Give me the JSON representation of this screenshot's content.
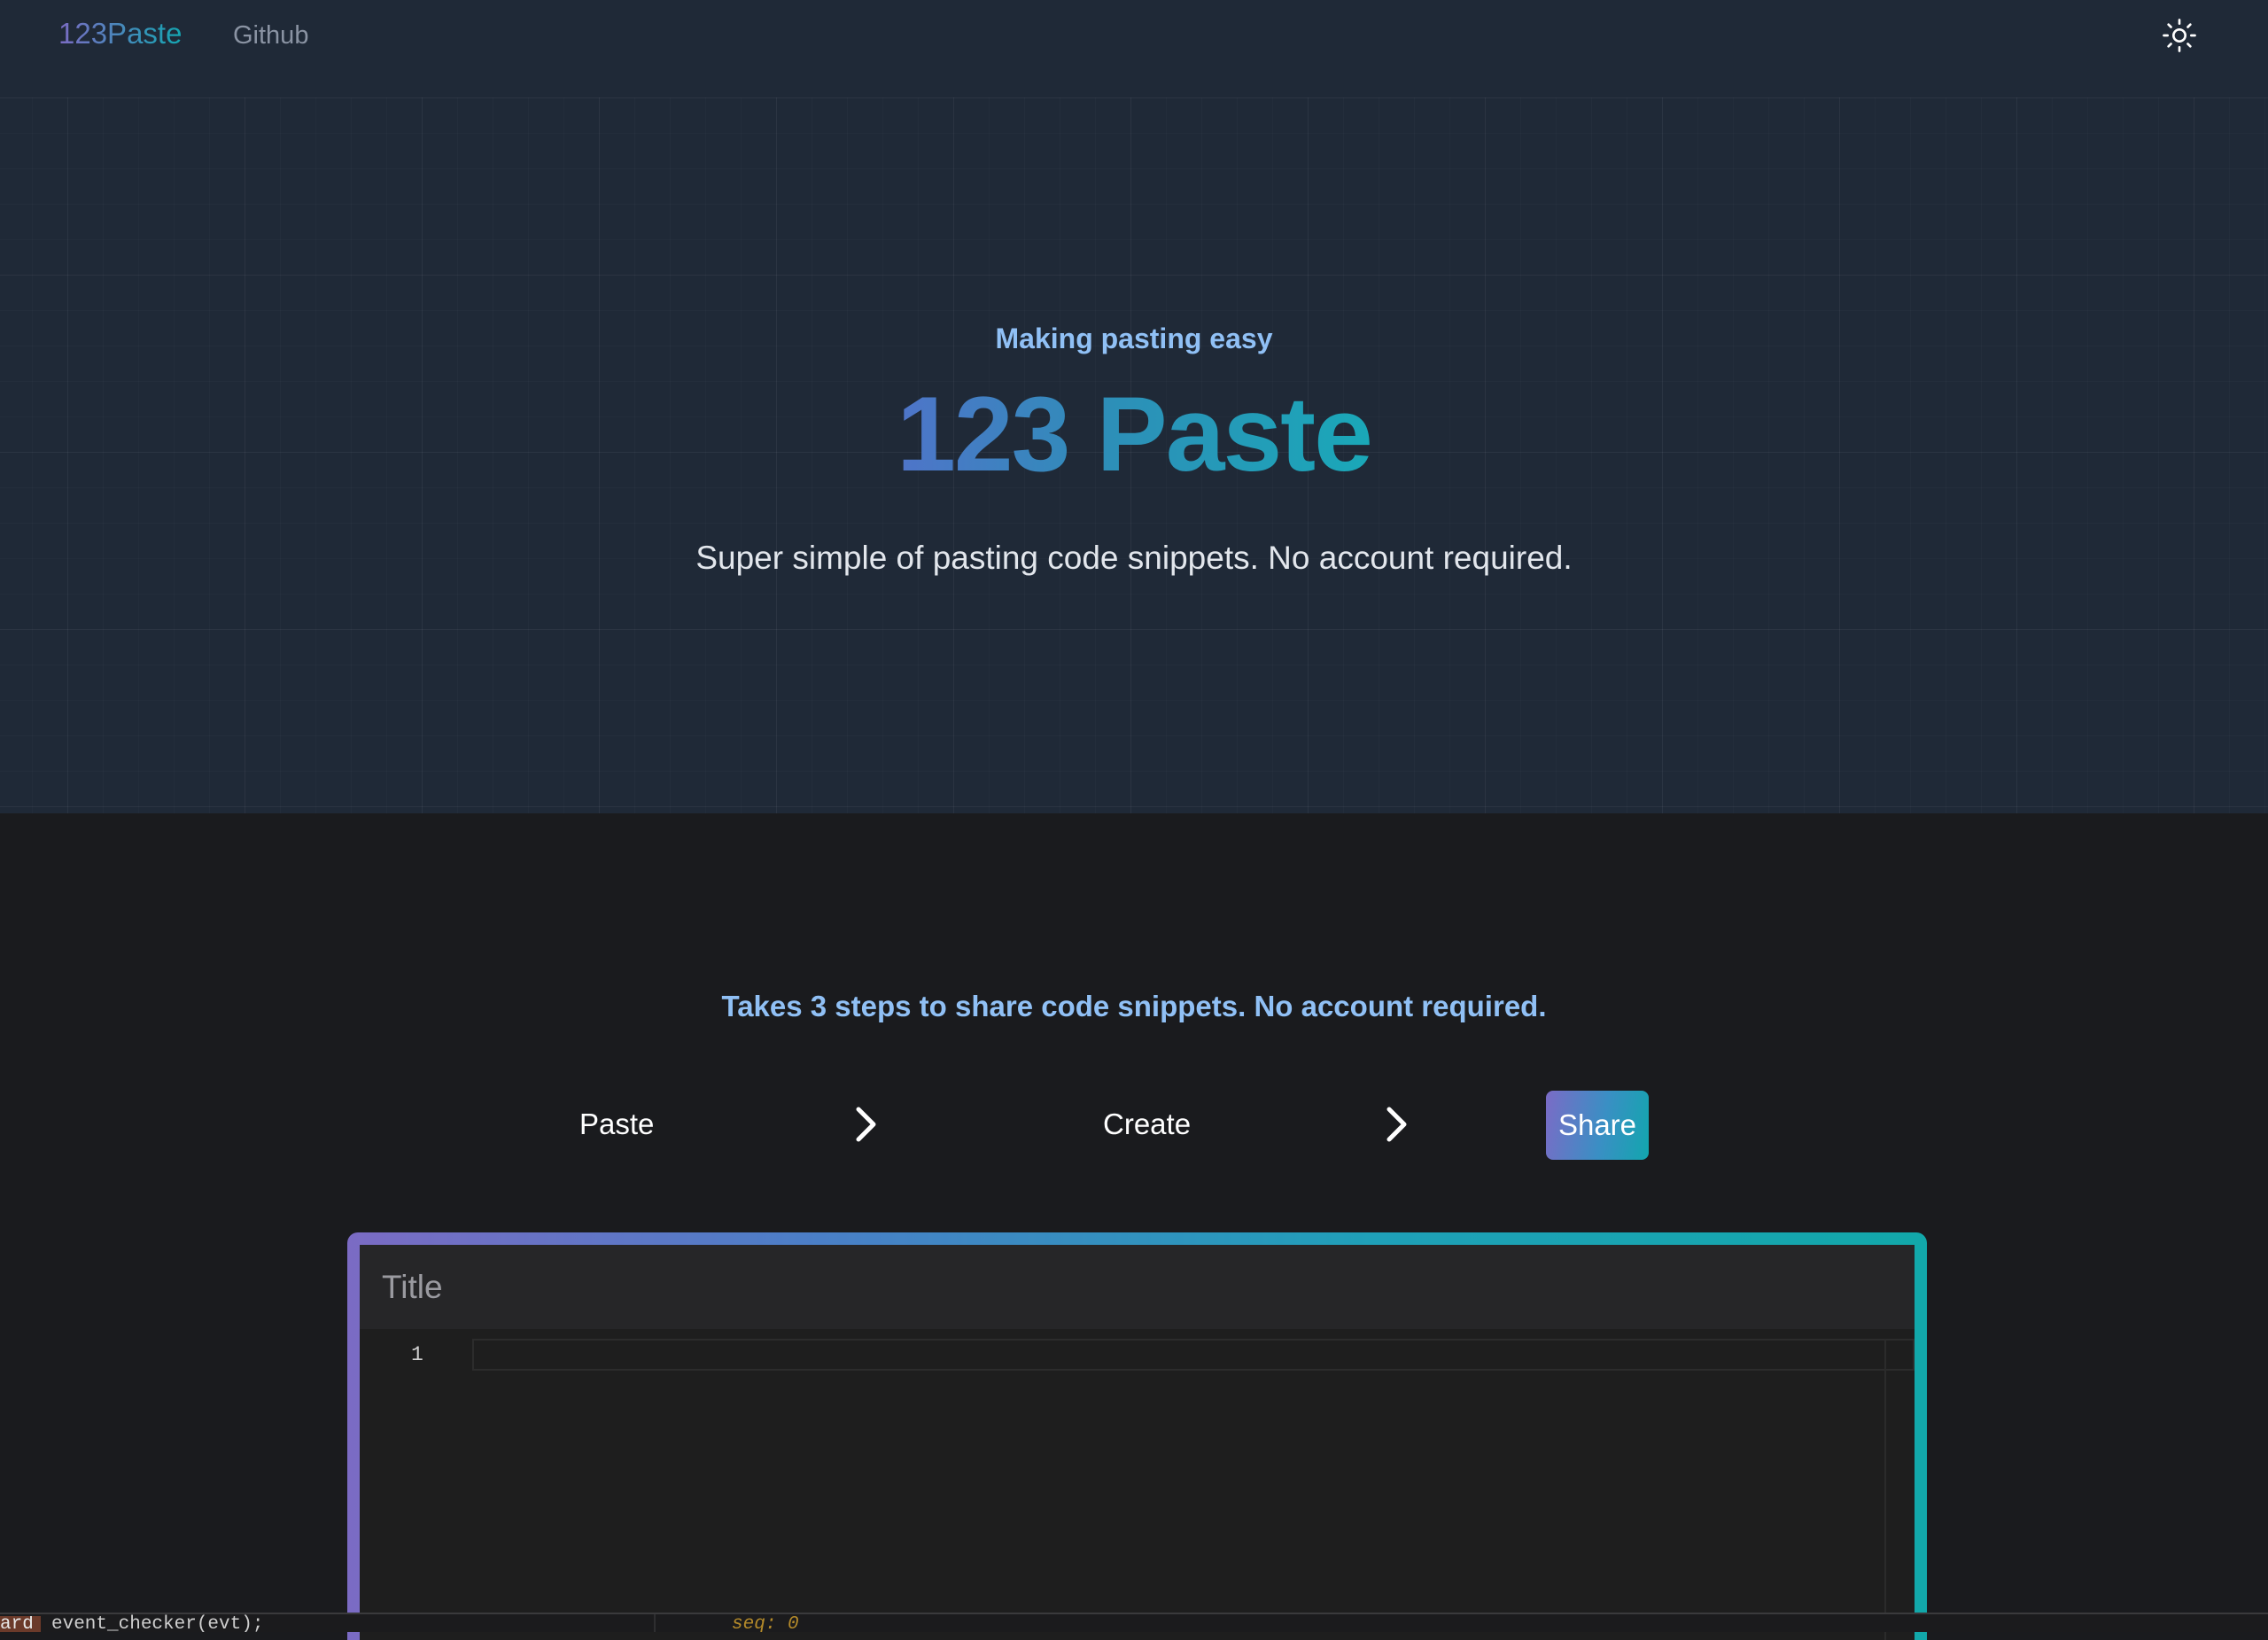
{
  "nav": {
    "brand": "123Paste",
    "github_label": "Github",
    "theme_icon": "sun-icon"
  },
  "hero": {
    "eyebrow": "Making pasting easy",
    "title": "123 Paste",
    "subtitle": "Super simple of pasting code snippets. No account required."
  },
  "steps": {
    "heading": "Takes 3 steps to share code snippets. No account required.",
    "items": [
      "Paste",
      "Create",
      "Share"
    ],
    "separator_icon": "chevron-right-icon"
  },
  "editor": {
    "title_placeholder": "Title",
    "line_numbers": [
      "1"
    ]
  },
  "devtools_strip": {
    "tag": "ard",
    "text": "event_checker(evt);",
    "code": "seq: 0"
  },
  "colors": {
    "accent_blue": "#90c0f5",
    "gradient_start": "#7b6bc4",
    "gradient_end": "#12a8aa",
    "hero_bg": "#1f2937",
    "page_bg": "#1a1b1e"
  }
}
